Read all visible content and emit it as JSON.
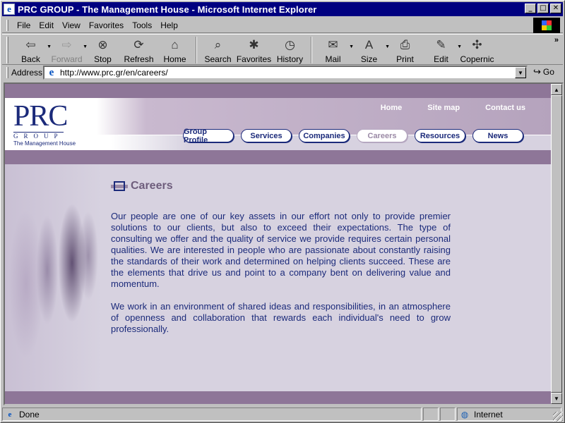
{
  "window": {
    "title": "PRC GROUP - The Management House - Microsoft Internet Explorer"
  },
  "menu": [
    "File",
    "Edit",
    "View",
    "Favorites",
    "Tools",
    "Help"
  ],
  "toolbar": [
    {
      "label": "Back",
      "icon": "back-arrow-icon",
      "glyph": "⇦",
      "dropdown": true,
      "disabled": false
    },
    {
      "label": "Forward",
      "icon": "forward-arrow-icon",
      "glyph": "⇨",
      "dropdown": true,
      "disabled": true
    },
    {
      "label": "Stop",
      "icon": "stop-icon",
      "glyph": "⊗",
      "dropdown": false,
      "disabled": false
    },
    {
      "label": "Refresh",
      "icon": "refresh-icon",
      "glyph": "⟳",
      "dropdown": false,
      "disabled": false
    },
    {
      "label": "Home",
      "icon": "home-icon",
      "glyph": "⌂",
      "dropdown": false,
      "disabled": false
    },
    {
      "label": "Search",
      "icon": "search-icon",
      "glyph": "⌕",
      "dropdown": false,
      "disabled": false
    },
    {
      "label": "Favorites",
      "icon": "favorites-icon",
      "glyph": "✱",
      "dropdown": false,
      "disabled": false
    },
    {
      "label": "History",
      "icon": "history-icon",
      "glyph": "◷",
      "dropdown": false,
      "disabled": false
    },
    {
      "label": "Mail",
      "icon": "mail-icon",
      "glyph": "✉",
      "dropdown": true,
      "disabled": false
    },
    {
      "label": "Size",
      "icon": "text-size-icon",
      "glyph": "A",
      "dropdown": true,
      "disabled": false
    },
    {
      "label": "Print",
      "icon": "print-icon",
      "glyph": "⎙",
      "dropdown": false,
      "disabled": false
    },
    {
      "label": "Edit",
      "icon": "edit-icon",
      "glyph": "✎",
      "dropdown": true,
      "disabled": false
    },
    {
      "label": "Copernic",
      "icon": "copernic-icon",
      "glyph": "✣",
      "dropdown": false,
      "disabled": false
    }
  ],
  "address": {
    "label": "Address",
    "url": "http://www.prc.gr/en/careers/",
    "go_label": "Go"
  },
  "site": {
    "logo": {
      "name": "PRC",
      "group": "GROUP",
      "tagline": "The Management House"
    },
    "top_links": [
      "Home",
      "Site map",
      "Contact us"
    ],
    "nav": [
      {
        "label": "Group Profile",
        "active": false,
        "width": 72
      },
      {
        "label": "Services",
        "active": false,
        "width": 72
      },
      {
        "label": "Companies",
        "active": false,
        "width": 72
      },
      {
        "label": "Careers",
        "active": true,
        "width": 72
      },
      {
        "label": "Resources",
        "active": false,
        "width": 72
      },
      {
        "label": "News",
        "active": false,
        "width": 72
      }
    ],
    "heading": "Careers",
    "paragraphs": [
      "Our people are one of our key assets in our effort not only to provide premier solutions to our clients, but also to exceed their expectations. The type of consulting we offer and the quality of service we provide requires certain personal qualities. We are interested in people who are passionate about constantly raising the standards of their work and determined on helping clients succeed. These are the elements that drive us and point to a company bent on delivering value and momentum.",
      "We work in an environment of shared ideas and responsibilities, in an atmosphere of openness and collaboration that rewards each individual's need to grow professionally."
    ]
  },
  "status": {
    "text": "Done",
    "zone": "Internet"
  },
  "colors": {
    "accent_purple": "#8e7698",
    "navy": "#1b2a7a",
    "page_bg": "#d7d2e0"
  }
}
